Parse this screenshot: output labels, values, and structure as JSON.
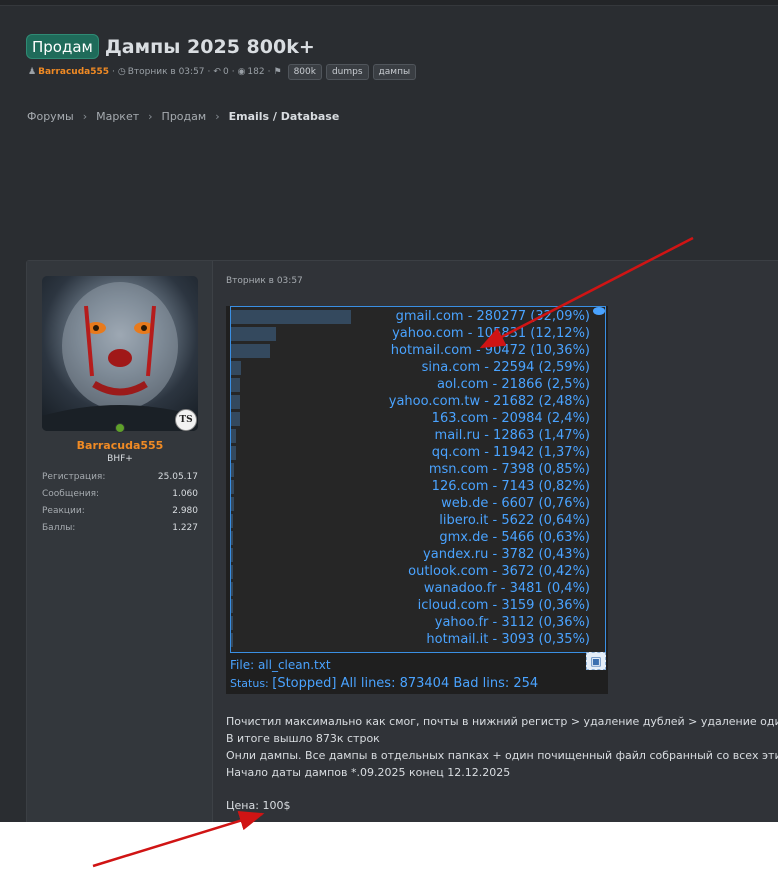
{
  "thread": {
    "prefix": "Продам",
    "title": "Дампы 2025 800k+",
    "author": "Barracuda555",
    "date": "Вторник в 03:57",
    "replies": "0",
    "views": "182",
    "tags": [
      "800k",
      "dumps",
      "дампы"
    ]
  },
  "breadcrumb": [
    "Форумы",
    "Маркет",
    "Продам",
    "Emails / Database"
  ],
  "user": {
    "name": "Barracuda555",
    "title": "BHF+",
    "badge": "TS",
    "stats": [
      {
        "label": "Регистрация:",
        "value": "25.05.17"
      },
      {
        "label": "Сообщения:",
        "value": "1.060"
      },
      {
        "label": "Реакции:",
        "value": "2.980"
      },
      {
        "label": "Баллы:",
        "value": "1.227"
      }
    ]
  },
  "post": {
    "date": "Вторник в 03:57",
    "domain_stats": [
      {
        "text": "gmail.com - 280277 (32,09%)",
        "pct": 32.09
      },
      {
        "text": "yahoo.com - 105831 (12,12%)",
        "pct": 12.12
      },
      {
        "text": "hotmail.com - 90472 (10,36%)",
        "pct": 10.36
      },
      {
        "text": "sina.com - 22594 (2,59%)",
        "pct": 2.59
      },
      {
        "text": "aol.com - 21866 (2,5%)",
        "pct": 2.5
      },
      {
        "text": "yahoo.com.tw - 21682 (2,48%)",
        "pct": 2.48
      },
      {
        "text": "163.com - 20984 (2,4%)",
        "pct": 2.4
      },
      {
        "text": "mail.ru - 12863 (1,47%)",
        "pct": 1.47
      },
      {
        "text": "qq.com - 11942 (1,37%)",
        "pct": 1.37
      },
      {
        "text": "msn.com - 7398 (0,85%)",
        "pct": 0.85
      },
      {
        "text": "126.com - 7143 (0,82%)",
        "pct": 0.82
      },
      {
        "text": "web.de - 6607 (0,76%)",
        "pct": 0.76
      },
      {
        "text": "libero.it - 5622 (0,64%)",
        "pct": 0.64
      },
      {
        "text": "gmx.de - 5466 (0,63%)",
        "pct": 0.63
      },
      {
        "text": "yandex.ru - 3782 (0,43%)",
        "pct": 0.43
      },
      {
        "text": "outlook.com - 3672 (0,42%)",
        "pct": 0.42
      },
      {
        "text": "wanadoo.fr - 3481 (0,4%)",
        "pct": 0.4
      },
      {
        "text": "icloud.com - 3159 (0,36%)",
        "pct": 0.36
      },
      {
        "text": "yahoo.fr - 3112 (0,36%)",
        "pct": 0.36
      },
      {
        "text": "hotmail.it - 3093 (0,35%)",
        "pct": 0.35
      }
    ],
    "file_label": "File: all_clean.txt",
    "status_label": "Status:",
    "status_value": "[Stopped] All lines: 873404 Bad lins: 254",
    "text_lines": [
      "Почистил максимально как смог, почты в нижний регистр > удаление дублей > удаление одинаков",
      "В итоге вышло 873к строк",
      "Онли дампы. Все дампы в отдельных папках + один почищенный файл собранный со всех этих дам",
      "Начало даты дампов *.09.2025 конец 12.12.2025"
    ],
    "price": "Цена: 100$"
  },
  "colors": {
    "background": "#2a2d31",
    "prefix_badge": "#1f6b5a",
    "author": "#f08a24",
    "stats_text": "#4aa3ff",
    "annotation_arrow": "#d01414"
  }
}
